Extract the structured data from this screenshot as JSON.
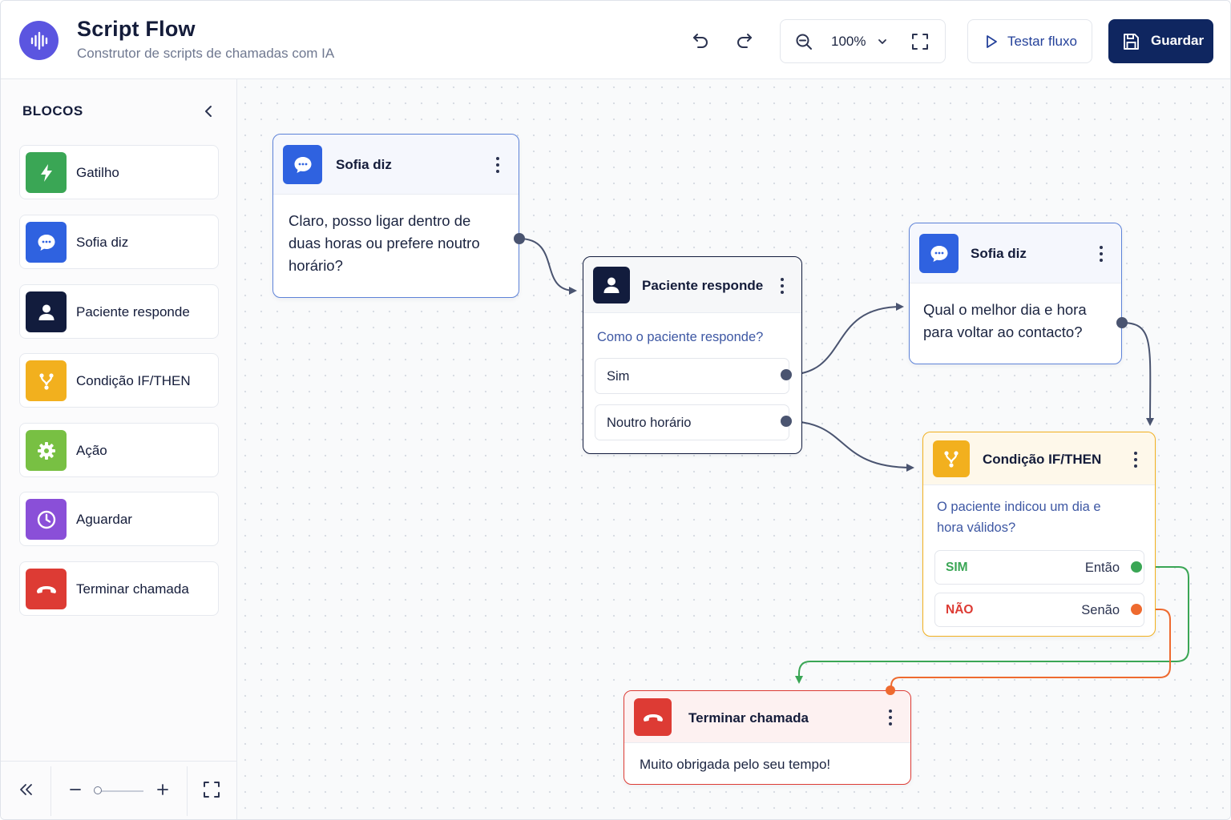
{
  "app": {
    "title": "Script Flow",
    "subtitle": "Construtor de scripts de chamadas com IA"
  },
  "toolbar": {
    "zoom": "100%",
    "test_label": "Testar fluxo",
    "save_label": "Guardar"
  },
  "sidebar": {
    "title": "BLOCOS",
    "items": [
      {
        "label": "Gatilho",
        "icon": "bolt-icon",
        "color": "#3aa655"
      },
      {
        "label": "Sofia diz",
        "icon": "chat-bubble-icon",
        "color": "#2f62e0"
      },
      {
        "label": "Paciente responde",
        "icon": "user-icon",
        "color": "#121c3d"
      },
      {
        "label": "Condição IF/THEN",
        "icon": "branch-icon",
        "color": "#f2b01e"
      },
      {
        "label": "Ação",
        "icon": "gear-icon",
        "color": "#78c043"
      },
      {
        "label": "Aguardar",
        "icon": "clock-icon",
        "color": "#8a4fd8"
      },
      {
        "label": "Terminar chamada",
        "icon": "hangup-icon",
        "color": "#dd3b34"
      }
    ]
  },
  "nodes": {
    "sofia1": {
      "title": "Sofia diz",
      "text": "Claro, posso ligar dentro de duas horas ou prefere noutro horário?"
    },
    "paciente": {
      "title": "Paciente responde",
      "question": "Como o paciente responde?",
      "options": [
        "Sim",
        "Noutro horário"
      ]
    },
    "sofia2": {
      "title": "Sofia diz",
      "text": "Qual o melhor dia e hora para voltar ao contacto?"
    },
    "condicao": {
      "title": "Condição IF/THEN",
      "question": "O paciente indicou um dia e hora válidos?",
      "yes_label": "SIM",
      "yes_action": "Então",
      "no_label": "NÃO",
      "no_action": "Senão"
    },
    "terminar": {
      "title": "Terminar chamada",
      "text": "Muito obrigada pelo seu tempo!"
    }
  },
  "colors": {
    "brand": "#5b55e0",
    "primary": "#0f2660",
    "message": "#2f62e0",
    "condition": "#f2b01e",
    "end": "#dd3b34",
    "yes_wire": "#3aa655",
    "no_wire": "#ee6a2f"
  }
}
